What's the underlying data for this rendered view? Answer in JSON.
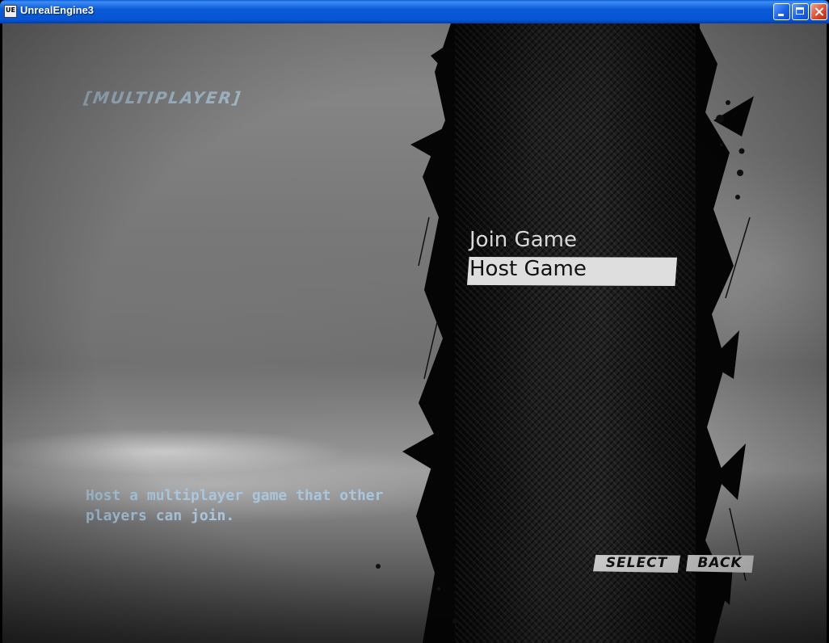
{
  "window": {
    "title": "UnrealEngine3"
  },
  "menu": {
    "header": "[MULTIPLAYER]",
    "items": [
      {
        "label": "Join Game",
        "selected": false
      },
      {
        "label": "Host Game",
        "selected": true
      }
    ],
    "description_lines": [
      "Host a multiplayer game that other",
      "players can join."
    ]
  },
  "footer": {
    "select_label": "SELECT",
    "back_label": "BACK"
  },
  "colors": {
    "header_text": "#a9c0d0",
    "description_text": "#a8c7de",
    "selected_bg": "#dedede"
  }
}
